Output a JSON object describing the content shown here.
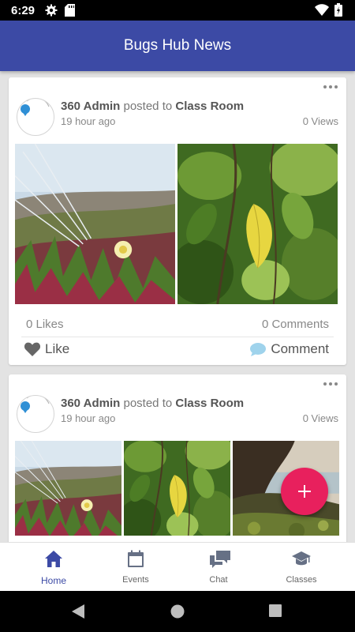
{
  "status_bar": {
    "time": "6:29"
  },
  "app_bar": {
    "title": "Bugs Hub News"
  },
  "posts": [
    {
      "author": "360 Admin",
      "posted_to_text": "posted to",
      "destination": "Class Room",
      "time_ago": "19 hour ago",
      "views": "0 Views",
      "likes": "0 Likes",
      "comments": "0 Comments",
      "like_label": "Like",
      "comment_label": "Comment"
    },
    {
      "author": "360 Admin",
      "posted_to_text": "posted to",
      "destination": "Class Room",
      "time_ago": "19 hour ago",
      "views": "0 Views"
    }
  ],
  "bottom_nav": {
    "items": [
      {
        "label": "Home",
        "icon": "home-icon",
        "active": true
      },
      {
        "label": "Events",
        "icon": "calendar-icon"
      },
      {
        "label": "Chat",
        "icon": "chat-bubbles-icon"
      },
      {
        "label": "Classes",
        "icon": "graduation-cap-icon"
      }
    ]
  },
  "colors": {
    "primary": "#3c4aa5",
    "accent": "#e8205d",
    "like_icon": "#666666",
    "comment_icon": "#9fd3ec"
  }
}
